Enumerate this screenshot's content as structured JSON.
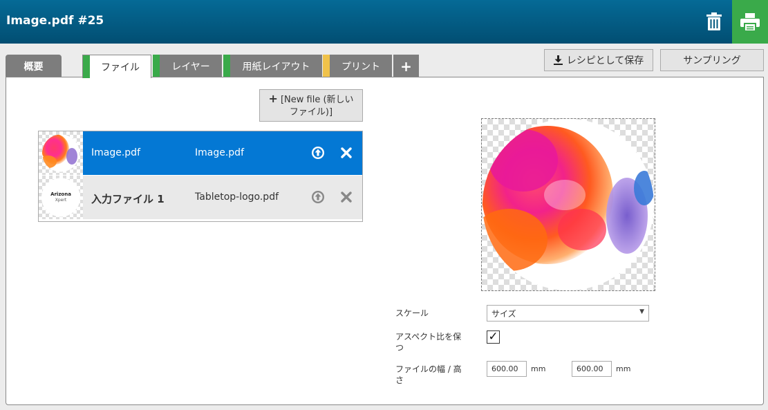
{
  "header": {
    "title": "Image.pdf #25"
  },
  "tabs": [
    {
      "label": "概要"
    },
    {
      "label": "ファイル",
      "color": "#3aaa4a"
    },
    {
      "label": "レイヤー",
      "color": "#3aaa4a"
    },
    {
      "label": "用紙レイアウト",
      "color": "#3aaa4a"
    },
    {
      "label": "プリント",
      "color": "#f0c24a"
    },
    {
      "label": "+"
    }
  ],
  "toolbar": {
    "save_recipe_label": "レシピとして保存",
    "sampling_label": "サンプリング"
  },
  "files": {
    "new_file_label": "[New file (新しいファイル)]",
    "rows": [
      {
        "name": "Image.pdf",
        "file": "Image.pdf",
        "selected": true
      },
      {
        "name": "入力ファイル 1",
        "file": "Tabletop-logo.pdf",
        "selected": false
      }
    ],
    "logo_text": "Arizona",
    "logo_subtext": "Xpert"
  },
  "properties": {
    "scale_label": "スケール",
    "scale_value": "サイズ",
    "aspect_label": "アスペクト比を保つ",
    "aspect_checked": true,
    "size_label": "ファイルの幅 / 高さ",
    "width_value": "600.00",
    "height_value": "600.00",
    "unit": "mm"
  },
  "colors": {
    "header": "#02587f",
    "accent_green": "#3aaa4a",
    "selected_row": "#0478d4"
  }
}
